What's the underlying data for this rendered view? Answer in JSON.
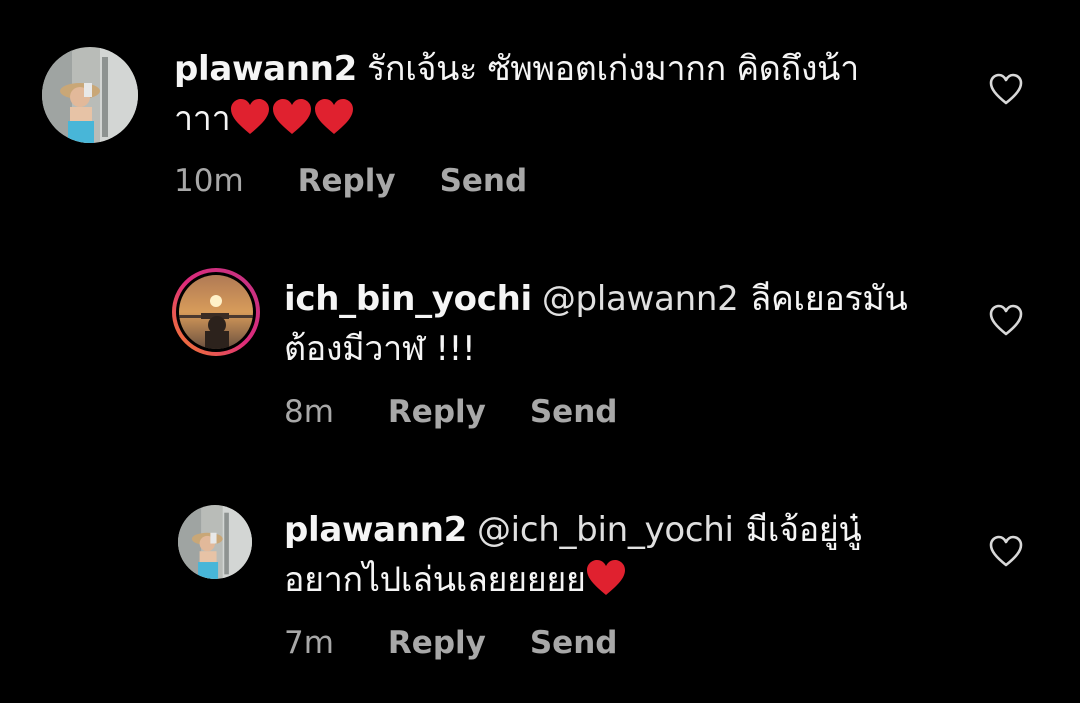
{
  "comments": [
    {
      "username": "plawann2",
      "mention": "",
      "text_line1": "รักเจ้นะ ซัพพอตเก่งมากก คิดถึงน้า",
      "text_line2": "าาา",
      "hearts": 3,
      "time": "10m",
      "reply_label": "Reply",
      "send_label": "Send"
    },
    {
      "username": "ich_bin_yochi",
      "mention": "@plawann2",
      "text_line1": "ลีคเยอรมัน",
      "text_line2": "ต้องมีวาฬ !!!",
      "hearts": 0,
      "time": "8m",
      "reply_label": "Reply",
      "send_label": "Send"
    },
    {
      "username": "plawann2",
      "mention": "@ich_bin_yochi",
      "text_line1": "มีเจ้อยู่นู๋",
      "text_line2": "อยากไปเล่นเลยยยยย",
      "hearts": 1,
      "time": "7m",
      "reply_label": "Reply",
      "send_label": "Send"
    }
  ],
  "colors": {
    "background": "#000000",
    "text": "#f5f5f5",
    "meta": "#a8a8a8",
    "heart_emoji": "#e0212f",
    "story_ring_start": "#f58529",
    "story_ring_end": "#c13584"
  },
  "icons": {
    "like": "heart-outline-icon",
    "emoji": "red-heart-emoji"
  }
}
